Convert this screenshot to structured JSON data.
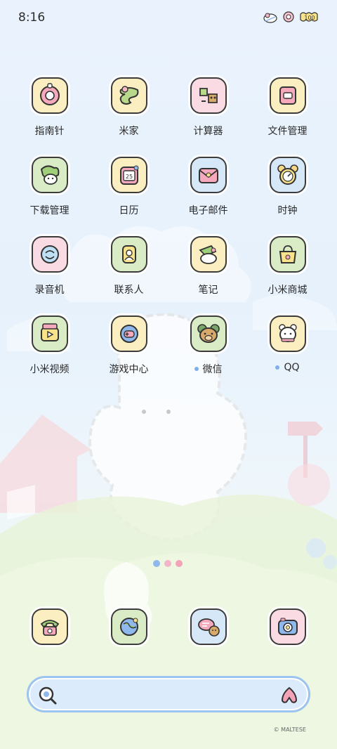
{
  "status": {
    "time": "8:16",
    "icons": [
      "sheep-icon",
      "flower-icon",
      "battery-100-icon"
    ],
    "battery_label": "100"
  },
  "apps": [
    {
      "label": "指南针",
      "icon": "compass-icon",
      "bg": "#fbeec0",
      "dot": false
    },
    {
      "label": "米家",
      "icon": "mijia-icon",
      "bg": "#fbeec0",
      "dot": false
    },
    {
      "label": "计算器",
      "icon": "calculator-icon",
      "bg": "#fadbe4",
      "dot": false
    },
    {
      "label": "文件管理",
      "icon": "folder-icon",
      "bg": "#fbeec0",
      "dot": false
    },
    {
      "label": "下载管理",
      "icon": "download-icon",
      "bg": "#d9ecc6",
      "dot": false
    },
    {
      "label": "日历",
      "icon": "calendar-icon",
      "bg": "#fbeec0",
      "dot": false
    },
    {
      "label": "电子邮件",
      "icon": "mail-icon",
      "bg": "#d6e8f8",
      "dot": false
    },
    {
      "label": "时钟",
      "icon": "clock-icon",
      "bg": "#d6e8f8",
      "dot": false
    },
    {
      "label": "录音机",
      "icon": "recorder-icon",
      "bg": "#fadbe4",
      "dot": false
    },
    {
      "label": "联系人",
      "icon": "contacts-icon",
      "bg": "#d9ecc6",
      "dot": false
    },
    {
      "label": "笔记",
      "icon": "notes-icon",
      "bg": "#fbeec0",
      "dot": false
    },
    {
      "label": "小米商城",
      "icon": "mi-store-icon",
      "bg": "#d9ecc6",
      "dot": false
    },
    {
      "label": "小米视频",
      "icon": "mi-video-icon",
      "bg": "#d9ecc6",
      "dot": false
    },
    {
      "label": "游戏中心",
      "icon": "game-center-icon",
      "bg": "#fbeec0",
      "dot": false
    },
    {
      "label": "微信",
      "icon": "wechat-icon",
      "bg": "#d9ecc6",
      "dot": true
    },
    {
      "label": "QQ",
      "icon": "qq-icon",
      "bg": "#fbeec0",
      "dot": true
    }
  ],
  "pager": {
    "pages": 3,
    "colors": [
      "#8fb8ec",
      "#f3b6c9",
      "#f3a3b8"
    ]
  },
  "dock": [
    {
      "icon": "phone-icon",
      "bg": "#fbeec0"
    },
    {
      "icon": "browser-icon",
      "bg": "#d9ecc6"
    },
    {
      "icon": "messages-icon",
      "bg": "#d6e8f8"
    },
    {
      "icon": "camera-icon",
      "bg": "#fadbe4"
    }
  ],
  "search": {
    "icon": "search-icon",
    "assistant_icon": "xiaoai-icon"
  },
  "copyright": "© MALTESE",
  "accent": "#9cc4ee"
}
